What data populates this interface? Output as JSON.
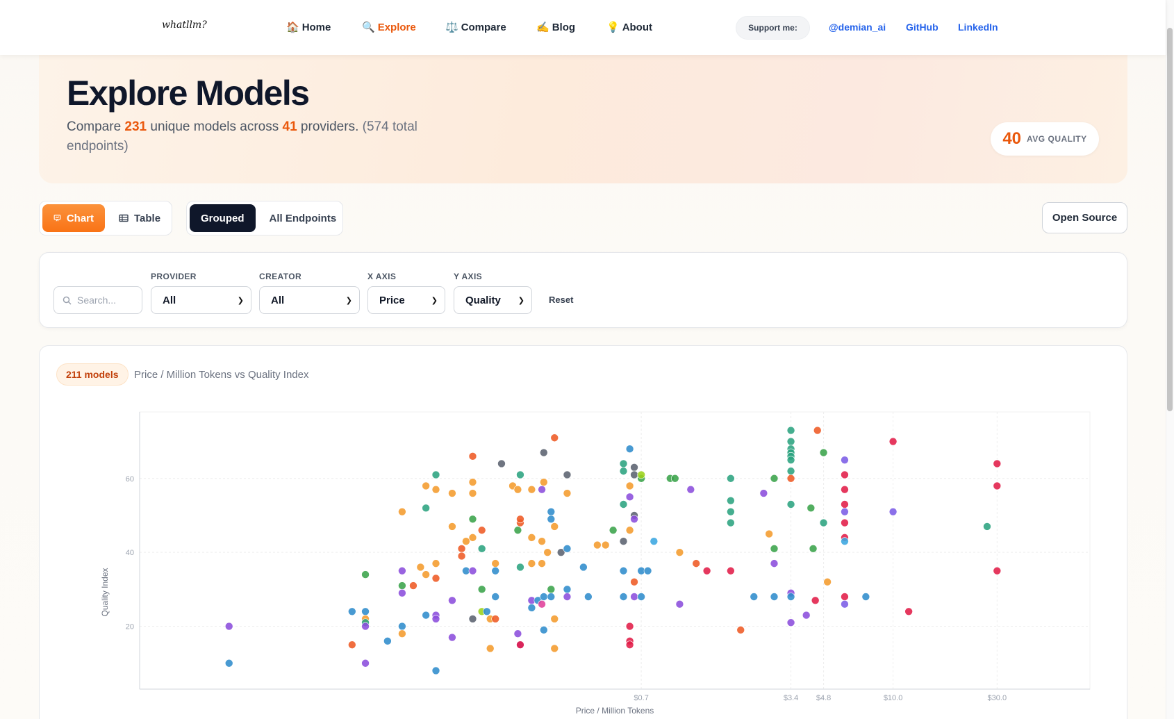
{
  "nav": {
    "logo": "whatllm?",
    "links": [
      {
        "icon": "🏠",
        "label": "Home",
        "active": false
      },
      {
        "icon": "🔍",
        "label": "Explore",
        "active": true
      },
      {
        "icon": "⚖️",
        "label": "Compare",
        "active": false
      },
      {
        "icon": "✍️",
        "label": "Blog",
        "active": false
      },
      {
        "icon": "💡",
        "label": "About",
        "active": false
      }
    ],
    "support_label": "Support me:",
    "social": [
      "@demian_ai",
      "GitHub",
      "LinkedIn"
    ]
  },
  "hero": {
    "title": "Explore Models",
    "sub_prefix": "Compare ",
    "models_count": "231",
    "sub_mid": " unique models across ",
    "providers_count": "41",
    "sub_suffix": " providers.",
    "endpoints_note": "(574 total endpoints)",
    "avg_value": "40",
    "avg_label": "AVG QUALITY"
  },
  "view_toggle": {
    "chart": "Chart",
    "table": "Table",
    "active": "Chart"
  },
  "group_toggle": {
    "grouped": "Grouped",
    "all": "All Endpoints",
    "active": "Grouped"
  },
  "open_source_label": "Open Source",
  "filters": {
    "search_placeholder": "Search...",
    "provider_label": "PROVIDER",
    "provider_value": "All",
    "creator_label": "CREATOR",
    "creator_value": "All",
    "xaxis_label": "X AXIS",
    "xaxis_value": "Price",
    "yaxis_label": "Y AXIS",
    "yaxis_value": "Quality",
    "reset_label": "Reset"
  },
  "chart_card": {
    "count_label": "211 models",
    "title": "Price / Million Tokens vs Quality Index"
  },
  "colors": {
    "accent": "#ea580c",
    "link": "#2563eb",
    "palette": {
      "teal": "#2ba37f",
      "orange": "#f49b2c",
      "red": "#e11d48",
      "blue": "#2f8ccc",
      "purple": "#8b4ddc",
      "gray": "#5b6270",
      "redorange": "#ee5a24",
      "green": "#3aa34a",
      "violet": "#7b5ce6",
      "pink": "#e0409a",
      "cyan": "#3aa6e0",
      "lime": "#9bd21a"
    }
  },
  "chart_data": {
    "type": "scatter",
    "xlabel": "Price / Million Tokens",
    "ylabel": "Quality Index",
    "x_scale": "log",
    "x_ticks": [
      {
        "v": 0.7,
        "label": "$0.7"
      },
      {
        "v": 3.4,
        "label": "$3.4"
      },
      {
        "v": 4.8,
        "label": "$4.8"
      },
      {
        "v": 10.0,
        "label": "$10.0"
      },
      {
        "v": 30.0,
        "label": "$30.0"
      }
    ],
    "y_ticks": [
      20,
      40,
      60
    ],
    "xlim": [
      0.0035,
      80
    ],
    "ylim": [
      3,
      78
    ],
    "grid": true,
    "points": [
      {
        "x": 0.009,
        "y": 20,
        "c": "purple"
      },
      {
        "x": 0.009,
        "y": 10,
        "c": "blue"
      },
      {
        "x": 0.033,
        "y": 24,
        "c": "blue"
      },
      {
        "x": 0.033,
        "y": 15,
        "c": "redorange"
      },
      {
        "x": 0.038,
        "y": 34,
        "c": "green"
      },
      {
        "x": 0.038,
        "y": 24,
        "c": "blue"
      },
      {
        "x": 0.038,
        "y": 22,
        "c": "orange"
      },
      {
        "x": 0.038,
        "y": 21,
        "c": "teal"
      },
      {
        "x": 0.038,
        "y": 20,
        "c": "purple"
      },
      {
        "x": 0.038,
        "y": 10,
        "c": "purple"
      },
      {
        "x": 0.048,
        "y": 16,
        "c": "blue"
      },
      {
        "x": 0.056,
        "y": 51,
        "c": "orange"
      },
      {
        "x": 0.056,
        "y": 35,
        "c": "purple"
      },
      {
        "x": 0.056,
        "y": 31,
        "c": "green"
      },
      {
        "x": 0.056,
        "y": 29,
        "c": "purple"
      },
      {
        "x": 0.056,
        "y": 20,
        "c": "blue"
      },
      {
        "x": 0.056,
        "y": 18,
        "c": "orange"
      },
      {
        "x": 0.063,
        "y": 31,
        "c": "redorange"
      },
      {
        "x": 0.068,
        "y": 36,
        "c": "orange"
      },
      {
        "x": 0.072,
        "y": 52,
        "c": "teal"
      },
      {
        "x": 0.072,
        "y": 58,
        "c": "orange"
      },
      {
        "x": 0.072,
        "y": 34,
        "c": "orange"
      },
      {
        "x": 0.072,
        "y": 23,
        "c": "blue"
      },
      {
        "x": 0.08,
        "y": 61,
        "c": "teal"
      },
      {
        "x": 0.08,
        "y": 57,
        "c": "orange"
      },
      {
        "x": 0.08,
        "y": 37,
        "c": "orange"
      },
      {
        "x": 0.08,
        "y": 33,
        "c": "redorange"
      },
      {
        "x": 0.08,
        "y": 23,
        "c": "purple"
      },
      {
        "x": 0.08,
        "y": 22,
        "c": "purple"
      },
      {
        "x": 0.08,
        "y": 8,
        "c": "blue"
      },
      {
        "x": 0.095,
        "y": 56,
        "c": "orange"
      },
      {
        "x": 0.095,
        "y": 47,
        "c": "orange"
      },
      {
        "x": 0.095,
        "y": 27,
        "c": "purple"
      },
      {
        "x": 0.095,
        "y": 17,
        "c": "purple"
      },
      {
        "x": 0.105,
        "y": 41,
        "c": "redorange"
      },
      {
        "x": 0.105,
        "y": 39,
        "c": "redorange"
      },
      {
        "x": 0.11,
        "y": 43,
        "c": "orange"
      },
      {
        "x": 0.11,
        "y": 35,
        "c": "blue"
      },
      {
        "x": 0.118,
        "y": 66,
        "c": "redorange"
      },
      {
        "x": 0.118,
        "y": 59,
        "c": "orange"
      },
      {
        "x": 0.118,
        "y": 56,
        "c": "orange"
      },
      {
        "x": 0.118,
        "y": 49,
        "c": "green"
      },
      {
        "x": 0.118,
        "y": 44,
        "c": "orange"
      },
      {
        "x": 0.118,
        "y": 35,
        "c": "purple"
      },
      {
        "x": 0.118,
        "y": 22,
        "c": "gray"
      },
      {
        "x": 0.13,
        "y": 46,
        "c": "redorange"
      },
      {
        "x": 0.13,
        "y": 41,
        "c": "teal"
      },
      {
        "x": 0.13,
        "y": 30,
        "c": "green"
      },
      {
        "x": 0.13,
        "y": 24,
        "c": "lime"
      },
      {
        "x": 0.137,
        "y": 24,
        "c": "blue"
      },
      {
        "x": 0.142,
        "y": 22,
        "c": "orange"
      },
      {
        "x": 0.142,
        "y": 14,
        "c": "orange"
      },
      {
        "x": 0.15,
        "y": 37,
        "c": "orange"
      },
      {
        "x": 0.15,
        "y": 35,
        "c": "blue"
      },
      {
        "x": 0.15,
        "y": 28,
        "c": "blue"
      },
      {
        "x": 0.15,
        "y": 22,
        "c": "redorange"
      },
      {
        "x": 0.16,
        "y": 64,
        "c": "gray"
      },
      {
        "x": 0.18,
        "y": 58,
        "c": "orange"
      },
      {
        "x": 0.19,
        "y": 57,
        "c": "orange"
      },
      {
        "x": 0.19,
        "y": 46,
        "c": "green"
      },
      {
        "x": 0.195,
        "y": 61,
        "c": "teal"
      },
      {
        "x": 0.195,
        "y": 48,
        "c": "redorange"
      },
      {
        "x": 0.195,
        "y": 49,
        "c": "redorange"
      },
      {
        "x": 0.195,
        "y": 36,
        "c": "teal"
      },
      {
        "x": 0.195,
        "y": 15,
        "c": "purple"
      },
      {
        "x": 0.195,
        "y": 15,
        "c": "red"
      },
      {
        "x": 0.19,
        "y": 18,
        "c": "purple"
      },
      {
        "x": 0.22,
        "y": 57,
        "c": "orange"
      },
      {
        "x": 0.22,
        "y": 44,
        "c": "orange"
      },
      {
        "x": 0.22,
        "y": 37,
        "c": "orange"
      },
      {
        "x": 0.22,
        "y": 27,
        "c": "purple"
      },
      {
        "x": 0.22,
        "y": 25,
        "c": "blue"
      },
      {
        "x": 0.235,
        "y": 27,
        "c": "blue"
      },
      {
        "x": 0.245,
        "y": 57,
        "c": "purple"
      },
      {
        "x": 0.245,
        "y": 43,
        "c": "orange"
      },
      {
        "x": 0.245,
        "y": 37,
        "c": "orange"
      },
      {
        "x": 0.245,
        "y": 26,
        "c": "pink"
      },
      {
        "x": 0.25,
        "y": 67,
        "c": "gray"
      },
      {
        "x": 0.25,
        "y": 59,
        "c": "orange"
      },
      {
        "x": 0.25,
        "y": 28,
        "c": "blue"
      },
      {
        "x": 0.25,
        "y": 19,
        "c": "blue"
      },
      {
        "x": 0.26,
        "y": 40,
        "c": "orange"
      },
      {
        "x": 0.27,
        "y": 51,
        "c": "blue"
      },
      {
        "x": 0.27,
        "y": 49,
        "c": "blue"
      },
      {
        "x": 0.27,
        "y": 30,
        "c": "green"
      },
      {
        "x": 0.27,
        "y": 28,
        "c": "blue"
      },
      {
        "x": 0.28,
        "y": 71,
        "c": "redorange"
      },
      {
        "x": 0.28,
        "y": 47,
        "c": "orange"
      },
      {
        "x": 0.28,
        "y": 22,
        "c": "orange"
      },
      {
        "x": 0.28,
        "y": 14,
        "c": "orange"
      },
      {
        "x": 0.3,
        "y": 40,
        "c": "gray"
      },
      {
        "x": 0.32,
        "y": 61,
        "c": "gray"
      },
      {
        "x": 0.32,
        "y": 56,
        "c": "orange"
      },
      {
        "x": 0.32,
        "y": 41,
        "c": "blue"
      },
      {
        "x": 0.32,
        "y": 30,
        "c": "blue"
      },
      {
        "x": 0.32,
        "y": 28,
        "c": "purple"
      },
      {
        "x": 0.38,
        "y": 36,
        "c": "blue"
      },
      {
        "x": 0.4,
        "y": 28,
        "c": "blue"
      },
      {
        "x": 0.44,
        "y": 42,
        "c": "orange"
      },
      {
        "x": 0.48,
        "y": 42,
        "c": "orange"
      },
      {
        "x": 0.52,
        "y": 46,
        "c": "green"
      },
      {
        "x": 0.58,
        "y": 64,
        "c": "teal"
      },
      {
        "x": 0.58,
        "y": 62,
        "c": "teal"
      },
      {
        "x": 0.58,
        "y": 53,
        "c": "teal"
      },
      {
        "x": 0.58,
        "y": 43,
        "c": "gray"
      },
      {
        "x": 0.58,
        "y": 35,
        "c": "blue"
      },
      {
        "x": 0.58,
        "y": 28,
        "c": "blue"
      },
      {
        "x": 0.62,
        "y": 68,
        "c": "blue"
      },
      {
        "x": 0.62,
        "y": 58,
        "c": "orange"
      },
      {
        "x": 0.62,
        "y": 55,
        "c": "purple"
      },
      {
        "x": 0.62,
        "y": 46,
        "c": "orange"
      },
      {
        "x": 0.62,
        "y": 20,
        "c": "red"
      },
      {
        "x": 0.62,
        "y": 16,
        "c": "red"
      },
      {
        "x": 0.62,
        "y": 15,
        "c": "red"
      },
      {
        "x": 0.65,
        "y": 63,
        "c": "gray"
      },
      {
        "x": 0.65,
        "y": 61,
        "c": "gray"
      },
      {
        "x": 0.65,
        "y": 50,
        "c": "gray"
      },
      {
        "x": 0.65,
        "y": 49,
        "c": "purple"
      },
      {
        "x": 0.65,
        "y": 32,
        "c": "redorange"
      },
      {
        "x": 0.65,
        "y": 28,
        "c": "purple"
      },
      {
        "x": 0.7,
        "y": 60,
        "c": "green"
      },
      {
        "x": 0.7,
        "y": 61,
        "c": "lime"
      },
      {
        "x": 0.7,
        "y": 35,
        "c": "blue"
      },
      {
        "x": 0.7,
        "y": 28,
        "c": "blue"
      },
      {
        "x": 0.75,
        "y": 35,
        "c": "blue"
      },
      {
        "x": 0.8,
        "y": 43,
        "c": "cyan"
      },
      {
        "x": 0.95,
        "y": 60,
        "c": "green"
      },
      {
        "x": 1.0,
        "y": 60,
        "c": "green"
      },
      {
        "x": 1.05,
        "y": 40,
        "c": "orange"
      },
      {
        "x": 1.05,
        "y": 26,
        "c": "purple"
      },
      {
        "x": 1.18,
        "y": 57,
        "c": "purple"
      },
      {
        "x": 1.25,
        "y": 37,
        "c": "redorange"
      },
      {
        "x": 1.4,
        "y": 35,
        "c": "red"
      },
      {
        "x": 1.8,
        "y": 60,
        "c": "teal"
      },
      {
        "x": 1.8,
        "y": 54,
        "c": "teal"
      },
      {
        "x": 1.8,
        "y": 51,
        "c": "teal"
      },
      {
        "x": 1.8,
        "y": 48,
        "c": "teal"
      },
      {
        "x": 1.8,
        "y": 35,
        "c": "red"
      },
      {
        "x": 2.0,
        "y": 19,
        "c": "redorange"
      },
      {
        "x": 2.3,
        "y": 28,
        "c": "blue"
      },
      {
        "x": 2.55,
        "y": 56,
        "c": "purple"
      },
      {
        "x": 2.7,
        "y": 45,
        "c": "orange"
      },
      {
        "x": 2.85,
        "y": 60,
        "c": "green"
      },
      {
        "x": 2.85,
        "y": 41,
        "c": "green"
      },
      {
        "x": 2.85,
        "y": 37,
        "c": "purple"
      },
      {
        "x": 2.85,
        "y": 28,
        "c": "blue"
      },
      {
        "x": 3.4,
        "y": 73,
        "c": "teal"
      },
      {
        "x": 3.4,
        "y": 70,
        "c": "teal"
      },
      {
        "x": 3.4,
        "y": 68,
        "c": "teal"
      },
      {
        "x": 3.4,
        "y": 67,
        "c": "teal"
      },
      {
        "x": 3.4,
        "y": 66,
        "c": "teal"
      },
      {
        "x": 3.4,
        "y": 65,
        "c": "teal"
      },
      {
        "x": 3.4,
        "y": 62,
        "c": "teal"
      },
      {
        "x": 3.4,
        "y": 60,
        "c": "redorange"
      },
      {
        "x": 3.4,
        "y": 53,
        "c": "teal"
      },
      {
        "x": 3.4,
        "y": 29,
        "c": "purple"
      },
      {
        "x": 3.4,
        "y": 28,
        "c": "blue"
      },
      {
        "x": 3.4,
        "y": 21,
        "c": "purple"
      },
      {
        "x": 4.0,
        "y": 23,
        "c": "purple"
      },
      {
        "x": 4.2,
        "y": 52,
        "c": "green"
      },
      {
        "x": 4.3,
        "y": 41,
        "c": "green"
      },
      {
        "x": 4.4,
        "y": 27,
        "c": "red"
      },
      {
        "x": 4.5,
        "y": 73,
        "c": "redorange"
      },
      {
        "x": 4.8,
        "y": 67,
        "c": "green"
      },
      {
        "x": 4.8,
        "y": 48,
        "c": "teal"
      },
      {
        "x": 5.0,
        "y": 32,
        "c": "orange"
      },
      {
        "x": 6.0,
        "y": 65,
        "c": "violet"
      },
      {
        "x": 6.0,
        "y": 61,
        "c": "red"
      },
      {
        "x": 6.0,
        "y": 57,
        "c": "red"
      },
      {
        "x": 6.0,
        "y": 53,
        "c": "red"
      },
      {
        "x": 6.0,
        "y": 51,
        "c": "violet"
      },
      {
        "x": 6.0,
        "y": 48,
        "c": "red"
      },
      {
        "x": 6.0,
        "y": 44,
        "c": "red"
      },
      {
        "x": 6.0,
        "y": 43,
        "c": "cyan"
      },
      {
        "x": 6.0,
        "y": 28,
        "c": "red"
      },
      {
        "x": 6.0,
        "y": 26,
        "c": "violet"
      },
      {
        "x": 7.5,
        "y": 28,
        "c": "blue"
      },
      {
        "x": 10.0,
        "y": 70,
        "c": "red"
      },
      {
        "x": 10.0,
        "y": 51,
        "c": "violet"
      },
      {
        "x": 11.8,
        "y": 24,
        "c": "red"
      },
      {
        "x": 27.0,
        "y": 47,
        "c": "teal"
      },
      {
        "x": 30.0,
        "y": 64,
        "c": "red"
      },
      {
        "x": 30.0,
        "y": 58,
        "c": "red"
      },
      {
        "x": 30.0,
        "y": 35,
        "c": "red"
      }
    ]
  }
}
